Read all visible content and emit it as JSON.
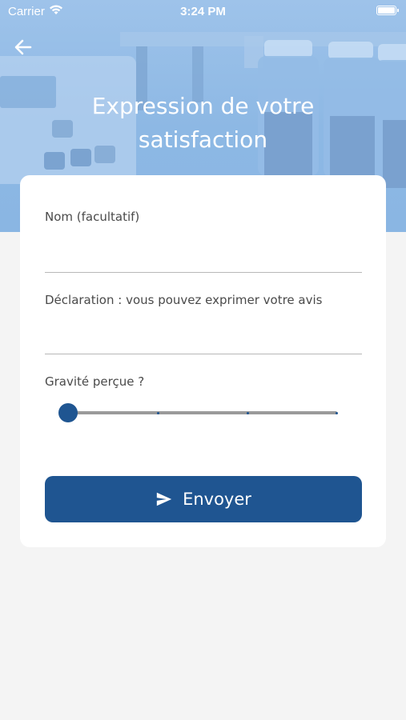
{
  "status_bar": {
    "carrier": "Carrier",
    "time": "3:24 PM"
  },
  "header": {
    "back_icon": "arrow-left-icon",
    "title": "Expression de votre satisfaction"
  },
  "form": {
    "name_label": "Nom (facultatif)",
    "name_value": "",
    "declaration_label": "Déclaration : vous pouvez exprimer votre avis",
    "declaration_value": "",
    "severity_label": "Gravité  perçue ?",
    "severity_slider": {
      "min": 0,
      "max": 3,
      "value": 0,
      "steps": 4
    },
    "submit_label": "Envoyer",
    "submit_icon": "paper-plane-icon"
  },
  "colors": {
    "primary": "#1f5591",
    "hero_tint": "#8db8e4",
    "background": "#f4f4f4"
  }
}
